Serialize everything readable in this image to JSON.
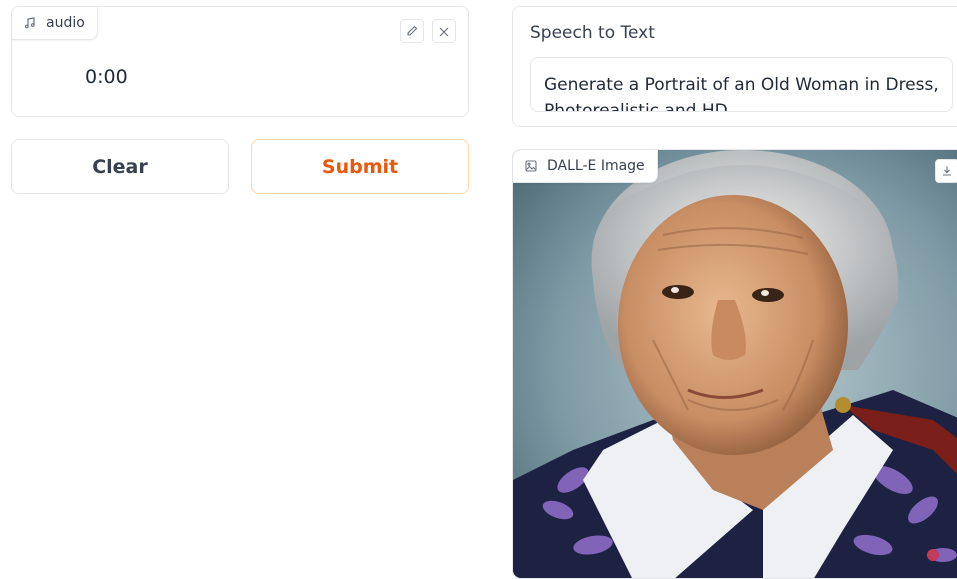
{
  "audio": {
    "label": "audio",
    "time": "0:00",
    "icons": [
      "music-note-icon",
      "pencil-icon",
      "close-icon"
    ]
  },
  "actions": {
    "clear_label": "Clear",
    "submit_label": "Submit"
  },
  "speech_to_text": {
    "label": "Speech to Text",
    "value": "Generate a Portrait of an Old Woman in Dress, Photorealistic and HD"
  },
  "dalle": {
    "label": "DALL-E Image",
    "icons": [
      "image-icon",
      "download-icon"
    ]
  },
  "colors": {
    "accent": "#ea580c",
    "border": "#e5e7eb"
  }
}
